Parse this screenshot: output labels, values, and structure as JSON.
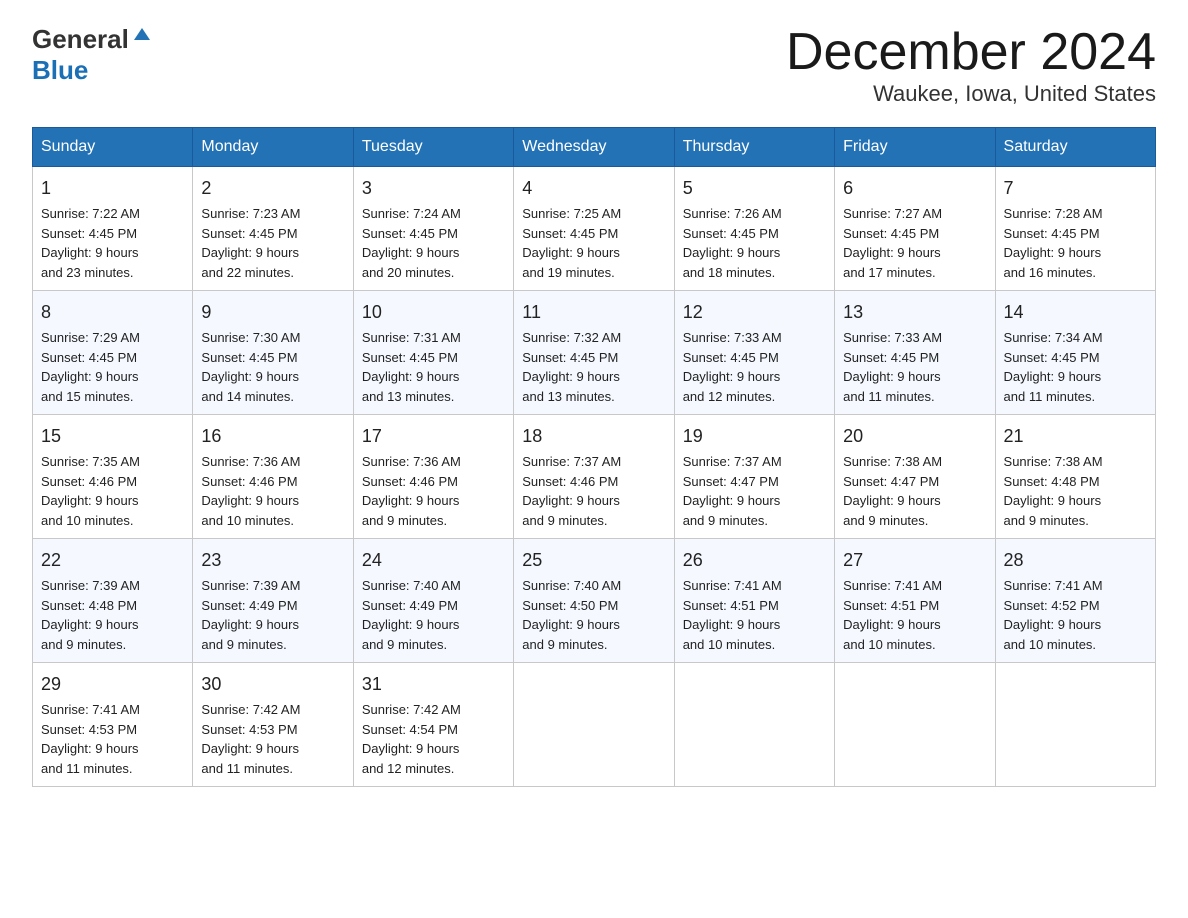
{
  "header": {
    "logo_line1": "General",
    "logo_line2": "Blue",
    "title": "December 2024",
    "subtitle": "Waukee, Iowa, United States"
  },
  "calendar": {
    "days_of_week": [
      "Sunday",
      "Monday",
      "Tuesday",
      "Wednesday",
      "Thursday",
      "Friday",
      "Saturday"
    ],
    "weeks": [
      [
        {
          "day": "1",
          "sunrise": "7:22 AM",
          "sunset": "4:45 PM",
          "daylight": "9 hours and 23 minutes."
        },
        {
          "day": "2",
          "sunrise": "7:23 AM",
          "sunset": "4:45 PM",
          "daylight": "9 hours and 22 minutes."
        },
        {
          "day": "3",
          "sunrise": "7:24 AM",
          "sunset": "4:45 PM",
          "daylight": "9 hours and 20 minutes."
        },
        {
          "day": "4",
          "sunrise": "7:25 AM",
          "sunset": "4:45 PM",
          "daylight": "9 hours and 19 minutes."
        },
        {
          "day": "5",
          "sunrise": "7:26 AM",
          "sunset": "4:45 PM",
          "daylight": "9 hours and 18 minutes."
        },
        {
          "day": "6",
          "sunrise": "7:27 AM",
          "sunset": "4:45 PM",
          "daylight": "9 hours and 17 minutes."
        },
        {
          "day": "7",
          "sunrise": "7:28 AM",
          "sunset": "4:45 PM",
          "daylight": "9 hours and 16 minutes."
        }
      ],
      [
        {
          "day": "8",
          "sunrise": "7:29 AM",
          "sunset": "4:45 PM",
          "daylight": "9 hours and 15 minutes."
        },
        {
          "day": "9",
          "sunrise": "7:30 AM",
          "sunset": "4:45 PM",
          "daylight": "9 hours and 14 minutes."
        },
        {
          "day": "10",
          "sunrise": "7:31 AM",
          "sunset": "4:45 PM",
          "daylight": "9 hours and 13 minutes."
        },
        {
          "day": "11",
          "sunrise": "7:32 AM",
          "sunset": "4:45 PM",
          "daylight": "9 hours and 13 minutes."
        },
        {
          "day": "12",
          "sunrise": "7:33 AM",
          "sunset": "4:45 PM",
          "daylight": "9 hours and 12 minutes."
        },
        {
          "day": "13",
          "sunrise": "7:33 AM",
          "sunset": "4:45 PM",
          "daylight": "9 hours and 11 minutes."
        },
        {
          "day": "14",
          "sunrise": "7:34 AM",
          "sunset": "4:45 PM",
          "daylight": "9 hours and 11 minutes."
        }
      ],
      [
        {
          "day": "15",
          "sunrise": "7:35 AM",
          "sunset": "4:46 PM",
          "daylight": "9 hours and 10 minutes."
        },
        {
          "day": "16",
          "sunrise": "7:36 AM",
          "sunset": "4:46 PM",
          "daylight": "9 hours and 10 minutes."
        },
        {
          "day": "17",
          "sunrise": "7:36 AM",
          "sunset": "4:46 PM",
          "daylight": "9 hours and 9 minutes."
        },
        {
          "day": "18",
          "sunrise": "7:37 AM",
          "sunset": "4:46 PM",
          "daylight": "9 hours and 9 minutes."
        },
        {
          "day": "19",
          "sunrise": "7:37 AM",
          "sunset": "4:47 PM",
          "daylight": "9 hours and 9 minutes."
        },
        {
          "day": "20",
          "sunrise": "7:38 AM",
          "sunset": "4:47 PM",
          "daylight": "9 hours and 9 minutes."
        },
        {
          "day": "21",
          "sunrise": "7:38 AM",
          "sunset": "4:48 PM",
          "daylight": "9 hours and 9 minutes."
        }
      ],
      [
        {
          "day": "22",
          "sunrise": "7:39 AM",
          "sunset": "4:48 PM",
          "daylight": "9 hours and 9 minutes."
        },
        {
          "day": "23",
          "sunrise": "7:39 AM",
          "sunset": "4:49 PM",
          "daylight": "9 hours and 9 minutes."
        },
        {
          "day": "24",
          "sunrise": "7:40 AM",
          "sunset": "4:49 PM",
          "daylight": "9 hours and 9 minutes."
        },
        {
          "day": "25",
          "sunrise": "7:40 AM",
          "sunset": "4:50 PM",
          "daylight": "9 hours and 9 minutes."
        },
        {
          "day": "26",
          "sunrise": "7:41 AM",
          "sunset": "4:51 PM",
          "daylight": "9 hours and 10 minutes."
        },
        {
          "day": "27",
          "sunrise": "7:41 AM",
          "sunset": "4:51 PM",
          "daylight": "9 hours and 10 minutes."
        },
        {
          "day": "28",
          "sunrise": "7:41 AM",
          "sunset": "4:52 PM",
          "daylight": "9 hours and 10 minutes."
        }
      ],
      [
        {
          "day": "29",
          "sunrise": "7:41 AM",
          "sunset": "4:53 PM",
          "daylight": "9 hours and 11 minutes."
        },
        {
          "day": "30",
          "sunrise": "7:42 AM",
          "sunset": "4:53 PM",
          "daylight": "9 hours and 11 minutes."
        },
        {
          "day": "31",
          "sunrise": "7:42 AM",
          "sunset": "4:54 PM",
          "daylight": "9 hours and 12 minutes."
        },
        null,
        null,
        null,
        null
      ]
    ],
    "labels": {
      "sunrise_prefix": "Sunrise: ",
      "sunset_prefix": "Sunset: ",
      "daylight_prefix": "Daylight: "
    }
  }
}
